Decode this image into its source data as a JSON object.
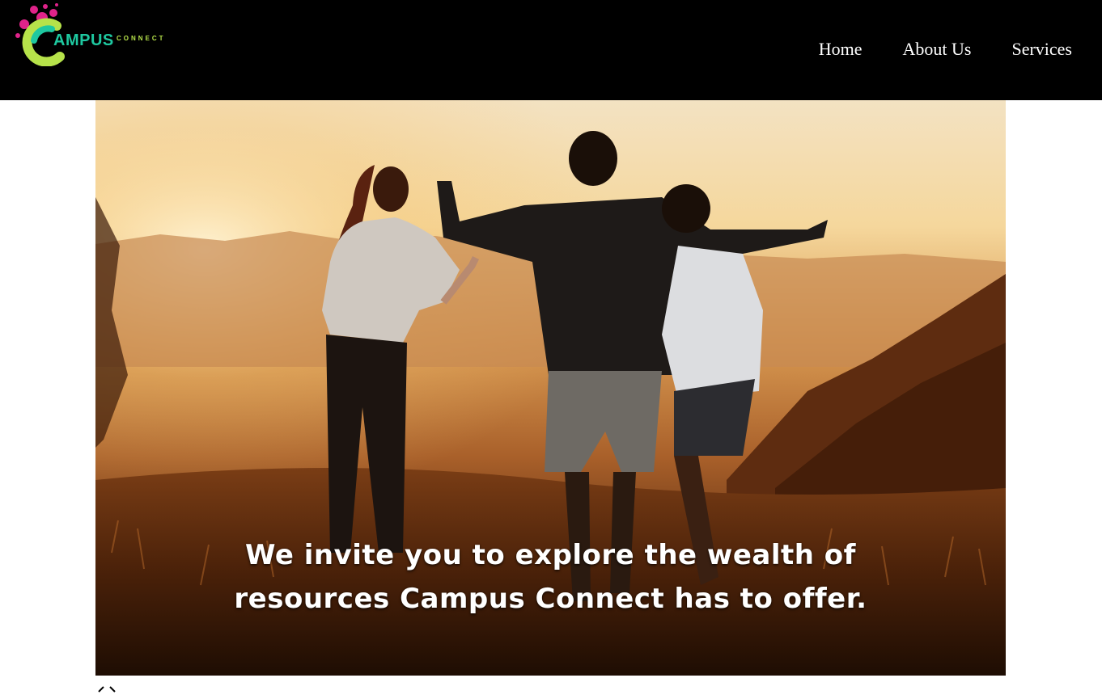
{
  "brand": {
    "name": "AMPUS",
    "sub": "CONNECT",
    "colors": {
      "primary": "#1ec8a0",
      "accent": "#e0238a",
      "lime": "#b6e24a"
    }
  },
  "nav": {
    "items": [
      {
        "label": "Home"
      },
      {
        "label": "About Us"
      },
      {
        "label": "Services"
      }
    ]
  },
  "hero": {
    "tagline_line1": "We invite you to explore the wealth of",
    "tagline_line2": "resources Campus Connect has to offer."
  },
  "carousel": {
    "indicator": "‹ ›"
  }
}
